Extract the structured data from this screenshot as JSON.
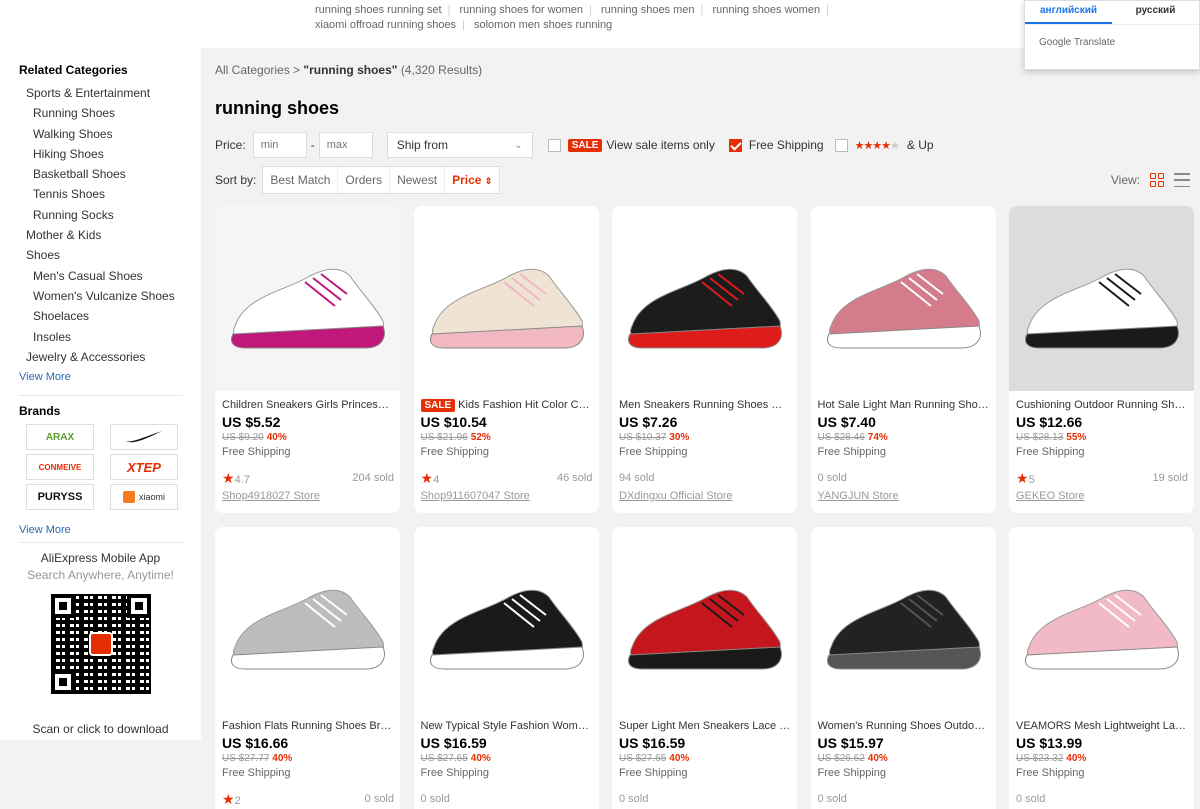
{
  "related_searches": [
    "running shoes running set",
    "running shoes for women",
    "running shoes men",
    "running shoes women",
    "xiaomi offroad running shoes",
    "solomon men shoes running"
  ],
  "translate": {
    "tabs": [
      "английский",
      "русский"
    ],
    "brand": "Google Translate"
  },
  "sidebar": {
    "related_title": "Related Categories",
    "categories": [
      {
        "label": "Sports & Entertainment",
        "level": 1
      },
      {
        "label": "Running Shoes",
        "level": 2
      },
      {
        "label": "Walking Shoes",
        "level": 2
      },
      {
        "label": "Hiking Shoes",
        "level": 2
      },
      {
        "label": "Basketball Shoes",
        "level": 2
      },
      {
        "label": "Tennis Shoes",
        "level": 2
      },
      {
        "label": "Running Socks",
        "level": 2
      },
      {
        "label": "Mother & Kids",
        "level": 1
      },
      {
        "label": "Shoes",
        "level": 1
      },
      {
        "label": "Men's Casual Shoes",
        "level": 2
      },
      {
        "label": "Women's Vulcanize Shoes",
        "level": 2
      },
      {
        "label": "Shoelaces",
        "level": 2
      },
      {
        "label": "Insoles",
        "level": 2
      },
      {
        "label": "Jewelry & Accessories",
        "level": 1
      }
    ],
    "view_more": "View More",
    "brands_title": "Brands",
    "brands": [
      "ARAX",
      "NIKE",
      "CONMEIVE",
      "XTEP",
      "PURYSS",
      "XIAOMI"
    ],
    "brands_view_more": "View More",
    "app_title": "AliExpress Mobile App",
    "app_subtitle": "Search Anywhere, Anytime!",
    "scan_text": "Scan or click to download"
  },
  "breadcrumb": {
    "root": "All Categories",
    "sep": ">",
    "query": "\"running shoes\"",
    "count": "(4,320 Results)"
  },
  "page_title": "running shoes",
  "filters": {
    "price_label": "Price:",
    "min_placeholder": "min",
    "dash": "-",
    "max_placeholder": "max",
    "ship_from": "Ship from",
    "sale_badge": "SALE",
    "sale_label": "View sale items only",
    "free_shipping_label": "Free Shipping",
    "rating_suffix": "& Up",
    "rating_stars": 4
  },
  "sort": {
    "label": "Sort by:",
    "options": [
      "Best Match",
      "Orders",
      "Newest",
      "Price"
    ],
    "view_label": "View:"
  },
  "products": [
    {
      "title": "Children Sneakers Girls Princess B...",
      "price": "US $5.52",
      "orig": "US $9.20",
      "discount": "40%",
      "shipping": "Free Shipping",
      "rating": "4.7",
      "sold": "204 sold",
      "store": "Shop4918027 Store",
      "sale": false,
      "color": "#f5f5f5",
      "shoe": "#ffffff",
      "accent": "#c0177a"
    },
    {
      "title": "Kids Fashion Hit Color Chil...",
      "price": "US $10.54",
      "orig": "US $21.96",
      "discount": "52%",
      "shipping": "Free Shipping",
      "rating": "4",
      "sold": "46 sold",
      "store": "Shop911607047 Store",
      "sale": true,
      "color": "#ffffff",
      "shoe": "#efe3d3",
      "accent": "#f2b8c2"
    },
    {
      "title": "Men Sneakers Running Shoes Wo...",
      "price": "US $7.26",
      "orig": "US $10.37",
      "discount": "30%",
      "shipping": "Free Shipping",
      "rating": "",
      "sold": "94 sold",
      "store": "DXdingxu Official Store",
      "sale": false,
      "color": "#ffffff",
      "shoe": "#1c1c1c",
      "accent": "#e01b1b"
    },
    {
      "title": "Hot Sale Light Man Running Shoes ...",
      "price": "US $7.40",
      "orig": "US $28.46",
      "discount": "74%",
      "shipping": "Free Shipping",
      "rating": "",
      "sold": "0 sold",
      "store": "YANGJUN Store",
      "sale": false,
      "color": "#ffffff",
      "shoe": "#d57c8c",
      "accent": "#ffffff"
    },
    {
      "title": "Cushioning Outdoor Running Shoe...",
      "price": "US $12.66",
      "orig": "US $28.13",
      "discount": "55%",
      "shipping": "Free Shipping",
      "rating": "5",
      "sold": "19 sold",
      "store": "GEKEO Store",
      "sale": false,
      "color": "#dcdcdc",
      "shoe": "#ffffff",
      "accent": "#1a1a1a"
    },
    {
      "title": "Fashion Flats Running Shoes Breat...",
      "price": "US $16.66",
      "orig": "US $27.77",
      "discount": "40%",
      "shipping": "Free Shipping",
      "rating": "2",
      "sold": "0 sold",
      "store": "",
      "sale": false,
      "color": "#ffffff",
      "shoe": "#bdbdbd",
      "accent": "#ffffff"
    },
    {
      "title": "New Typical Style Fashion Women ...",
      "price": "US $16.59",
      "orig": "US $27.65",
      "discount": "40%",
      "shipping": "Free Shipping",
      "rating": "",
      "sold": "0 sold",
      "store": "",
      "sale": false,
      "color": "#ffffff",
      "shoe": "#1a1a1a",
      "accent": "#ffffff"
    },
    {
      "title": "Super Light Men Sneakers Lace Up...",
      "price": "US $16.59",
      "orig": "US $27.65",
      "discount": "40%",
      "shipping": "Free Shipping",
      "rating": "",
      "sold": "0 sold",
      "store": "",
      "sale": false,
      "color": "#ffffff",
      "shoe": "#c4161c",
      "accent": "#1a1a1a"
    },
    {
      "title": "Women's Running Shoes Outdoor ...",
      "price": "US $15.97",
      "orig": "US $26.62",
      "discount": "40%",
      "shipping": "Free Shipping",
      "rating": "",
      "sold": "0 sold",
      "store": "",
      "sale": false,
      "color": "#ffffff",
      "shoe": "#222222",
      "accent": "#555555"
    },
    {
      "title": "VEAMORS Mesh Lightweight Ladie...",
      "price": "US $13.99",
      "orig": "US $23.32",
      "discount": "40%",
      "shipping": "Free Shipping",
      "rating": "",
      "sold": "0 sold",
      "store": "",
      "sale": false,
      "color": "#ffffff",
      "shoe": "#f2b9c6",
      "accent": "#ffffff"
    }
  ],
  "colors": {
    "accent": "#e62e04",
    "link": "#2e67b1"
  }
}
